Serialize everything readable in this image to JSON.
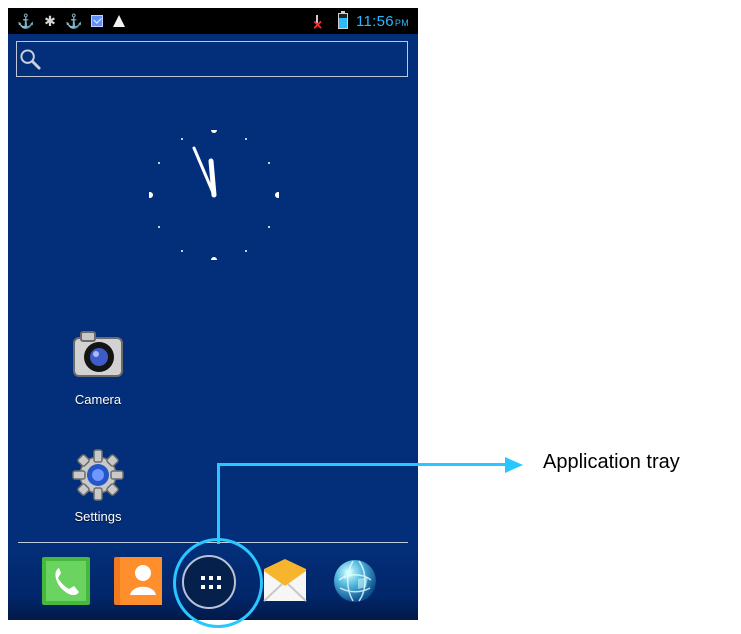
{
  "status_bar": {
    "time": "11:56",
    "ampm": "PM",
    "left_icons": [
      "usb-icon",
      "android-debug-icon",
      "usb-icon",
      "mail-notification-icon",
      "warning-icon"
    ],
    "right_icons": [
      "no-signal-icon",
      "battery-charging-icon"
    ]
  },
  "search": {
    "icon": "search-icon"
  },
  "clock": {
    "type": "analog",
    "hour": 11,
    "minute": 56
  },
  "desktop_apps": [
    {
      "label": "Camera",
      "icon": "camera-icon"
    },
    {
      "label": "Settings",
      "icon": "settings-gear-icon"
    }
  ],
  "dock": {
    "items": [
      "phone-icon",
      "contacts-icon",
      "app-tray-icon",
      "messaging-icon",
      "browser-globe-icon"
    ]
  },
  "annotation": {
    "label": "Application tray",
    "color": "#28c7ff"
  },
  "colors": {
    "wallpaper": "#032f7a",
    "status_text": "#2ab8ff",
    "highlight": "#28c7ff"
  }
}
